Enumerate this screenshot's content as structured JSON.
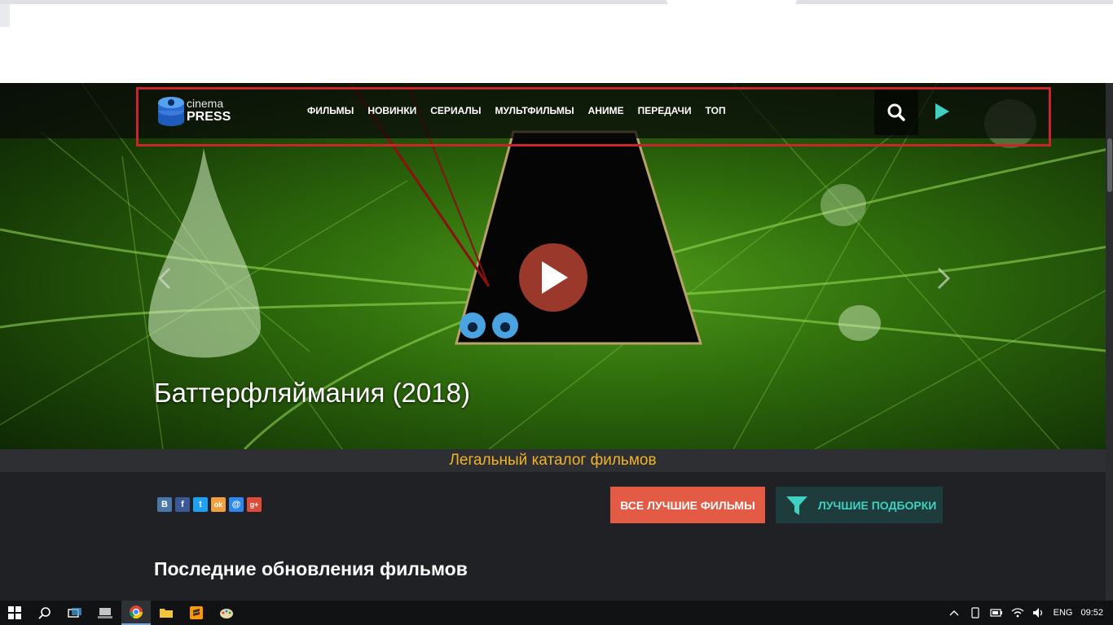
{
  "header": {
    "logo_word1": "cinema",
    "logo_word2": "PRESS"
  },
  "nav": {
    "items": [
      "ФИЛЬМЫ",
      "НОВИНКИ",
      "СЕРИАЛЫ",
      "МУЛЬТФИЛЬМЫ",
      "АНИМЕ",
      "ПЕРЕДАЧИ",
      "ТОП"
    ],
    "search_icon": "search-icon",
    "play_icon": "play-icon"
  },
  "hero": {
    "title": "Баттерфляймания (2018)",
    "play_icon": "play-icon",
    "prev_icon": "chevron-left-icon",
    "next_icon": "chevron-right-icon"
  },
  "tagline": "Легальный каталог фильмов",
  "share": {
    "buttons": [
      {
        "icon": "vk-icon",
        "glyph": "В",
        "color": "#4a76a8"
      },
      {
        "icon": "facebook-icon",
        "glyph": "f",
        "color": "#3b5998"
      },
      {
        "icon": "twitter-icon",
        "glyph": "t",
        "color": "#1da1f2"
      },
      {
        "icon": "odnoklassniki-icon",
        "glyph": "ok",
        "color": "#f2a03d"
      },
      {
        "icon": "mail-icon",
        "glyph": "@",
        "color": "#2d87f0"
      },
      {
        "icon": "google-plus-icon",
        "glyph": "g+",
        "color": "#dd4b39"
      }
    ]
  },
  "buttons": {
    "best_films": "ВСЕ ЛУЧШИЕ ФИЛЬМЫ",
    "best_collections": "ЛУЧШИЕ ПОДБОРКИ"
  },
  "section": {
    "title": "Последние обновления фильмов"
  },
  "taskbar": {
    "language": "ENG",
    "time": "09:52",
    "icons": [
      "windows-start-icon",
      "search-icon",
      "task-view-icon",
      "network-drive-icon",
      "chrome-icon",
      "file-explorer-icon",
      "sublime-text-icon",
      "paint-icon"
    ]
  },
  "colors": {
    "nav_highlight": "#c9262c",
    "play_button": "#c44836",
    "tagline": "#f0b429",
    "best_button": "#e35a45",
    "collections_button_bg": "#1e3c3c",
    "collections_button_text": "#3ed1c2",
    "accent_play": "#3ed1c2"
  }
}
